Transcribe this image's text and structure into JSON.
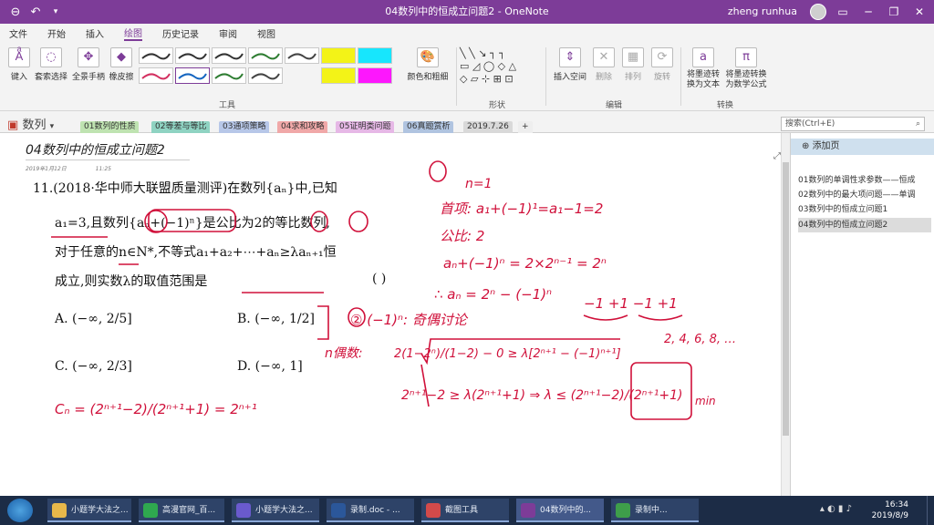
{
  "window": {
    "title": "04数列中的恒成立问题2 - OneNote",
    "user": "zheng runhua"
  },
  "menu": [
    "文件",
    "开始",
    "插入",
    "绘图",
    "历史记录",
    "审阅",
    "视图"
  ],
  "ribbon": {
    "tools": [
      "键入",
      "套索选择",
      "全景手柄",
      "橡皮擦"
    ],
    "group_tools": "工具",
    "color_thickness": "颜色和粗细",
    "group_shapes": "形状",
    "edit": [
      "插入空间",
      "删除",
      "排列",
      "旋转"
    ],
    "group_edit": "编辑",
    "convert": [
      "将墨迹转换为文本",
      "将墨迹转换为数学公式"
    ],
    "group_convert": "转换",
    "pen_colors": [
      "#333333",
      "#333333",
      "#333333",
      "#2e7d32",
      "#444444",
      "#f4f400",
      "#00e5ff",
      "#d33060",
      "#1565c0",
      "#2e7d32",
      "#444444",
      "#f4f400",
      "#ff00ff"
    ]
  },
  "notebook": {
    "name": "数列"
  },
  "tabs": [
    {
      "label": "01数列的性质",
      "color": "#bfe3b1"
    },
    {
      "label": "02等差与等比",
      "color": "#8fd3c2"
    },
    {
      "label": "03通项策略",
      "color": "#b7c7e8"
    },
    {
      "label": "04求和攻略",
      "color": "#f0a8a8"
    },
    {
      "label": "05证明类问题",
      "color": "#e6b8e6"
    },
    {
      "label": "06真题赏析",
      "color": "#b0c4e0"
    },
    {
      "label": "2019.7.26",
      "color": "#d9d9d9"
    },
    {
      "label": "+",
      "color": "#eeeeee"
    }
  ],
  "search": {
    "placeholder": "搜索(Ctrl+E)"
  },
  "page": {
    "title": "04数列中的恒成立问题2",
    "date": "2019年1月12日",
    "time": "11:25",
    "question": {
      "line1": "11.(2018·华中师大联盟质量测评)在数列{aₙ}中,已知",
      "line2": "a₁=3,且数列{aₙ+(−1)ⁿ}是公比为2的等比数列,",
      "line3": "对于任意的n∈N*,不等式a₁+a₂+⋯+aₙ≥λaₙ₊₁恒",
      "line4": "成立,则实数λ的取值范围是",
      "bracket": "(      )",
      "options": [
        {
          "key": "A.",
          "text": "(−∞, 2/5]"
        },
        {
          "key": "B.",
          "text": "(−∞, 1/2]"
        },
        {
          "key": "C.",
          "text": "(−∞, 2/3]"
        },
        {
          "key": "D.",
          "text": "(−∞, 1]"
        }
      ]
    },
    "ink_notes": {
      "step1": "n=1",
      "first_term": "首项: a₁+(−1)¹=a₁−1=2",
      "ratio": "公比: 2",
      "general": "aₙ+(−1)ⁿ = 2×2ⁿ⁻¹ = 2ⁿ",
      "result": "∴ aₙ = 2ⁿ − (−1)ⁿ",
      "alternating": "−1 +1 −1 +1",
      "evens": "2, 4, 6, 8, …",
      "step2": "② (−1)ⁿ: 奇偶讨论",
      "even_case": "n偶数:",
      "even_ineq": "2(1−2ⁿ)/(1−2) − 0 ≥ λ[2ⁿ⁺¹ − (−1)ⁿ⁺¹]",
      "derive": "2ⁿ⁺¹−2 ≥ λ(2ⁿ⁺¹+1) ⇒ λ ≤ (2ⁿ⁺¹−2)/(2ⁿ⁺¹+1)",
      "min_label": "min",
      "cn": "Cₙ = (2ⁿ⁺¹−2)/(2ⁿ⁺¹+1) = 2ⁿ⁺¹"
    }
  },
  "pages": [
    {
      "label": "01数列的单调性求参数——恒成",
      "active": false
    },
    {
      "label": "02数列中的最大项问题——单调",
      "active": false
    },
    {
      "label": "03数列中的恒成立问题1",
      "active": false
    },
    {
      "label": "04数列中的恒成立问题2",
      "active": true
    }
  ],
  "add_page": "添加页",
  "taskbar": {
    "items": [
      "小题学大法之...",
      "高漫官网_百...",
      "小题学大法之...",
      "录制.doc - ...",
      "截图工具",
      "04数列中的...",
      "录制中..."
    ],
    "time": "16:34",
    "date": "2019/8/9"
  }
}
